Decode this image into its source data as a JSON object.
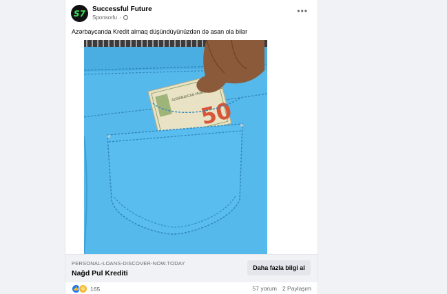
{
  "post": {
    "page_name": "Successful Future",
    "avatar_text": "S7",
    "sponsored_label": "Sponsorlu",
    "separator": "·",
    "caption": "Azərbaycanda Kredit almaq düşündüyünüzdən də asan ola bilər",
    "more_label": "•••"
  },
  "ad_image": {
    "banknote_value": "50",
    "banknote_text": "AZƏRBAYCAN MƏRKƏZİ BANKI"
  },
  "link": {
    "domain": "PERSONAL-LOANS-DISCOVER-NOW.TODAY",
    "title": "Nağd Pul Krediti",
    "cta_label": "Daha fazla bilgi al"
  },
  "footer": {
    "reaction_count": "165",
    "comments": "57 yorum",
    "shares": "2 Paylaşım",
    "reaction_icons": [
      "like-icon",
      "haha-icon"
    ]
  },
  "colors": {
    "jeans": "#56b9ec",
    "facebook_blue": "#1877f2",
    "avatar_green": "#3ddc5a"
  }
}
